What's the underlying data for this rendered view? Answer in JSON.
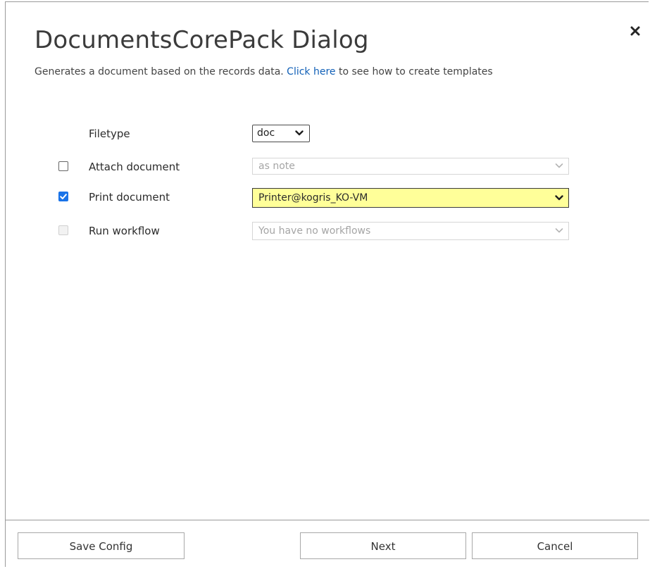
{
  "dialog": {
    "title": "DocumentsCorePack Dialog",
    "subtitle_prefix": "Generates a document based on the records data. ",
    "subtitle_link": "Click here",
    "subtitle_suffix": " to see how to create templates",
    "close_icon": "close-icon"
  },
  "form": {
    "filetype": {
      "label": "Filetype",
      "value": "doc"
    },
    "attach": {
      "label": "Attach document",
      "checked": false,
      "value": "as note"
    },
    "print": {
      "label": "Print document",
      "checked": true,
      "value": "Printer@kogris_KO-VM"
    },
    "workflow": {
      "label": "Run workflow",
      "checked": false,
      "disabled": true,
      "value": "You have no workflows"
    }
  },
  "footer": {
    "save_label": "Save Config",
    "next_label": "Next",
    "cancel_label": "Cancel"
  },
  "colors": {
    "link": "#1160b7",
    "highlight": "#ffff99",
    "checkbox_checked": "#1a73e8"
  }
}
